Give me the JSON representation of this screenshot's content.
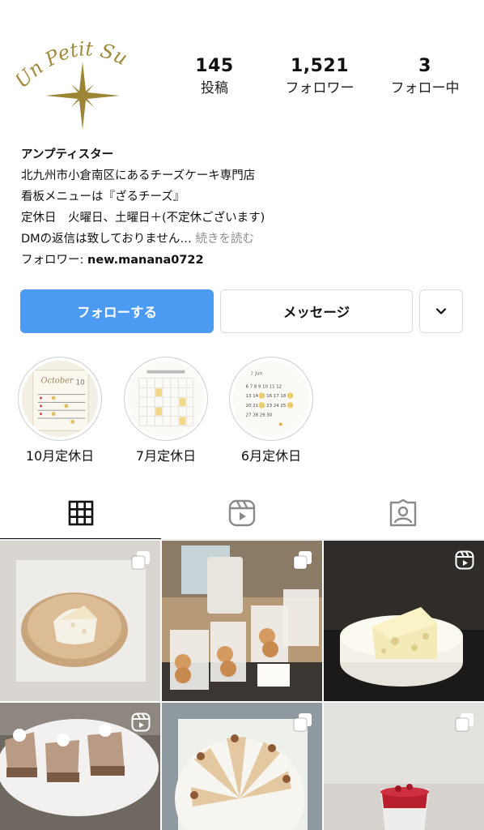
{
  "profile": {
    "avatar_text": "Un Petit Su",
    "stats": [
      {
        "value": "145",
        "label": "投稿"
      },
      {
        "value": "1,521",
        "label": "フォロワー"
      },
      {
        "value": "3",
        "label": "フォロー中"
      }
    ],
    "name": "アンプティスター",
    "bio_lines": [
      "北九州市小倉南区にあるチーズケーキ専門店",
      "看板メニューは『ざるチーズ』",
      "定休日　火曜日、土曜日＋(不定休ございます)"
    ],
    "bio_truncated": "DMの返信は致しておりません…",
    "more_link": "続きを読む",
    "follower_prefix": "フォロワー: ",
    "follower_name": "new.manana0722"
  },
  "actions": {
    "follow_label": "フォローする",
    "message_label": "メッセージ"
  },
  "highlights": [
    {
      "label": "10月定休日"
    },
    {
      "label": "7月定休日"
    },
    {
      "label": "6月定休日"
    }
  ],
  "tabs": [
    {
      "icon": "grid-icon",
      "active": true
    },
    {
      "icon": "reels-icon",
      "active": false
    },
    {
      "icon": "tagged-icon",
      "active": false
    }
  ],
  "posts": [
    {
      "subject": "cheesecake-on-wooden-plate",
      "badge": "multiple-icon"
    },
    {
      "subject": "cookies-in-gift-bags",
      "badge": "multiple-icon"
    },
    {
      "subject": "swiss-cheese-cake",
      "badge": "reels-icon"
    },
    {
      "subject": "chocolate-cake-slices",
      "badge": "reels-icon"
    },
    {
      "subject": "cake-slices-platter",
      "badge": "multiple-icon"
    },
    {
      "subject": "berry-cup-dessert",
      "badge": "multiple-icon"
    }
  ],
  "colors": {
    "follow_button": "#4c9bf2",
    "logo_gold": "#a08a3c"
  }
}
